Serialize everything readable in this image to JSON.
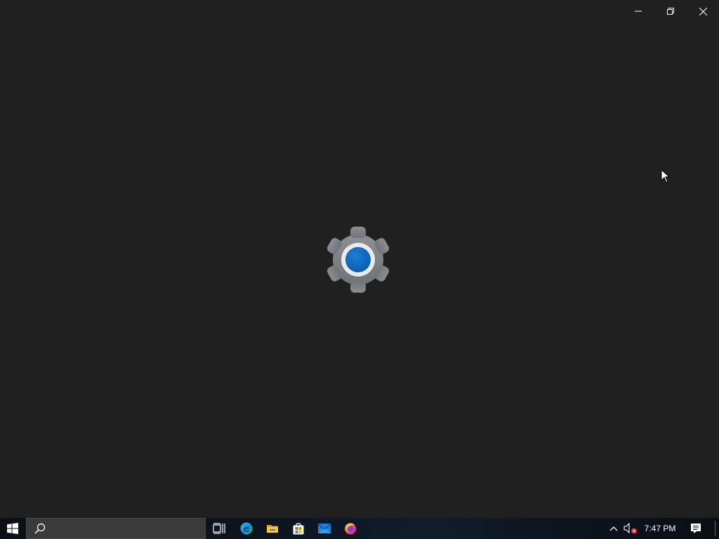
{
  "window": {
    "caption": {
      "minimize_icon": "minimize-icon",
      "maximize_icon": "restore-icon",
      "close_icon": "close-icon"
    },
    "splash": {
      "icon": "settings-gear-icon",
      "accent": "#0f6cbd",
      "background": "#202020"
    }
  },
  "taskbar": {
    "start_icon": "windows-logo-icon",
    "search": {
      "icon": "search-icon",
      "value": "",
      "placeholder": ""
    },
    "pinned": [
      {
        "name": "task-view",
        "icon": "task-view-icon"
      },
      {
        "name": "edge",
        "icon": "edge-icon"
      },
      {
        "name": "file-explorer",
        "icon": "folder-icon"
      },
      {
        "name": "store",
        "icon": "store-icon"
      },
      {
        "name": "mail",
        "icon": "mail-icon"
      },
      {
        "name": "firefox",
        "icon": "firefox-icon"
      }
    ],
    "tray": {
      "overflow_icon": "chevron-up-icon",
      "volume_icon": "volume-muted-icon",
      "time": "7:47 PM",
      "notifications_icon": "action-center-icon"
    }
  }
}
